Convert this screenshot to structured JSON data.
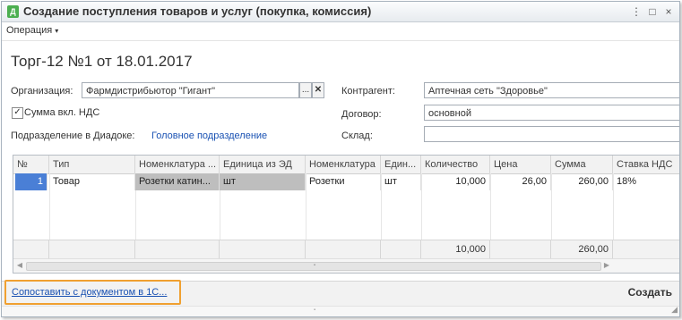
{
  "window": {
    "title": "Создание поступления товаров и услуг (покупка, комиссия)",
    "icon": "document-icon",
    "buttons": {
      "menu": "⋮",
      "maximize": "□",
      "close": "×"
    }
  },
  "menu": {
    "operation_label": "Операция",
    "arrow": "▾"
  },
  "document": {
    "title": "Торг-12 №1 от 18.01.2017"
  },
  "form": {
    "org_label": "Организация:",
    "org_value": "Фармдистрибьютор \"Гигант\"",
    "org_select_btn": "...",
    "org_clear_btn": "✕",
    "vat_checkbox_label": "Сумма вкл. НДС",
    "vat_checked": true,
    "vat_checkmark": "✓",
    "dept_label": "Подразделение в Диадоке:",
    "dept_value": "Головное подразделение",
    "contractor_label": "Контрагент:",
    "contractor_value": "Аптечная сеть \"Здоровье\"",
    "contract_label": "Договор:",
    "contract_value": "основной",
    "warehouse_label": "Склад:",
    "warehouse_value": ""
  },
  "table": {
    "columns": [
      "№",
      "Тип",
      "Номенклатура ...",
      "Единица из ЭД",
      "Номенклатура",
      "Един...",
      "Количество",
      "Цена",
      "Сумма",
      "Ставка НДС"
    ],
    "rows": [
      {
        "num": "1",
        "type": "Товар",
        "nom_ed": "Розетки катин...",
        "unit_ed": "шт",
        "nom": "Розетки",
        "unit": "шт",
        "qty": "10,000",
        "price": "26,00",
        "sum": "260,00",
        "vat": "18%"
      }
    ],
    "totals": {
      "qty": "10,000",
      "sum": "260,00"
    },
    "scroll_left": "◀",
    "scroll_right": "▶",
    "scroll_mid": "▪"
  },
  "footer": {
    "compare_link": "Сопоставить с документом в 1С...",
    "create_button": "Создать",
    "grip": "◢"
  }
}
